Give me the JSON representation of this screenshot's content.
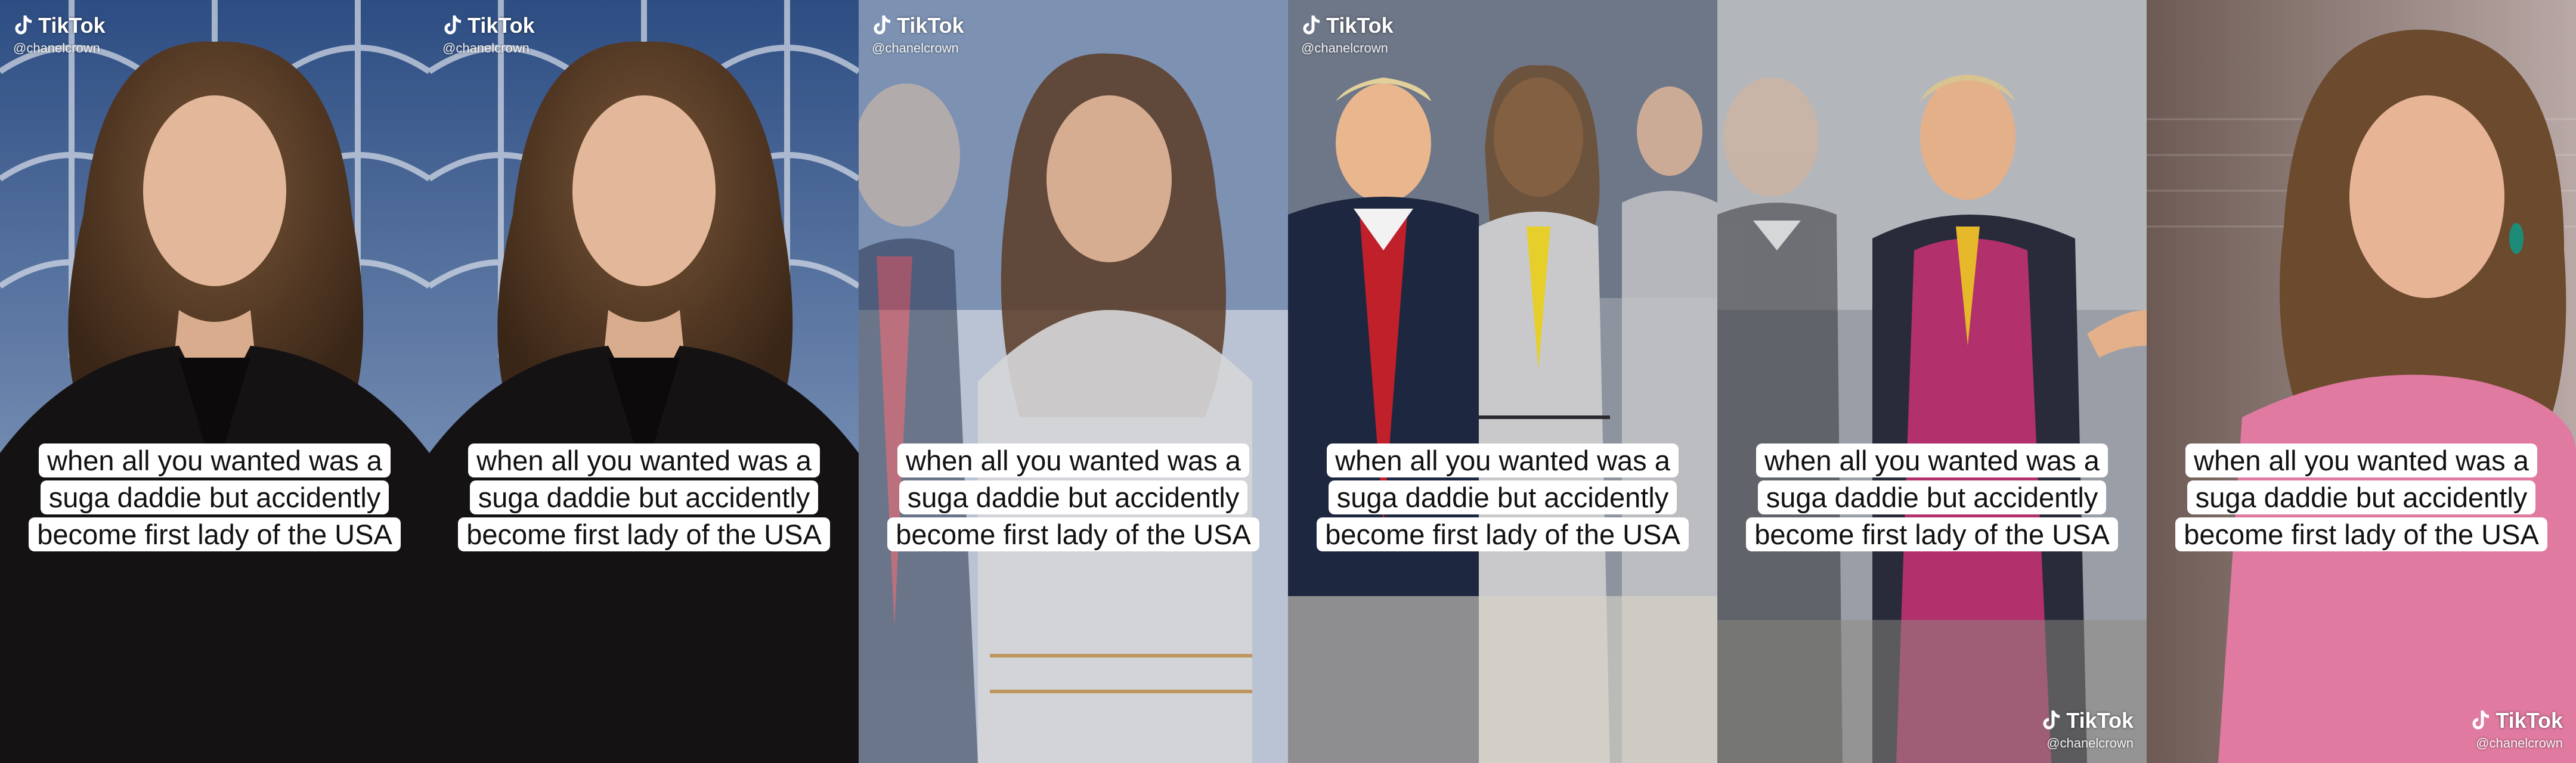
{
  "watermark": {
    "brand": "TikTok",
    "username": "@chanelcrown"
  },
  "caption": "when all you wanted was a suga daddie but accidently become first lady of the USA",
  "frames": [
    {
      "watermark_position": "top-left"
    },
    {
      "watermark_position": "top-left"
    },
    {
      "watermark_position": "top-left"
    },
    {
      "watermark_position": "top-left"
    },
    {
      "watermark_position": "bottom-right"
    },
    {
      "watermark_position": "bottom-right"
    }
  ],
  "colors": {
    "caption_bg": "#ffffff",
    "caption_text": "#111111",
    "tie_red": "#c0202a",
    "tie_yellow": "#e6cf2a",
    "pink_suit": "#b2306c"
  }
}
